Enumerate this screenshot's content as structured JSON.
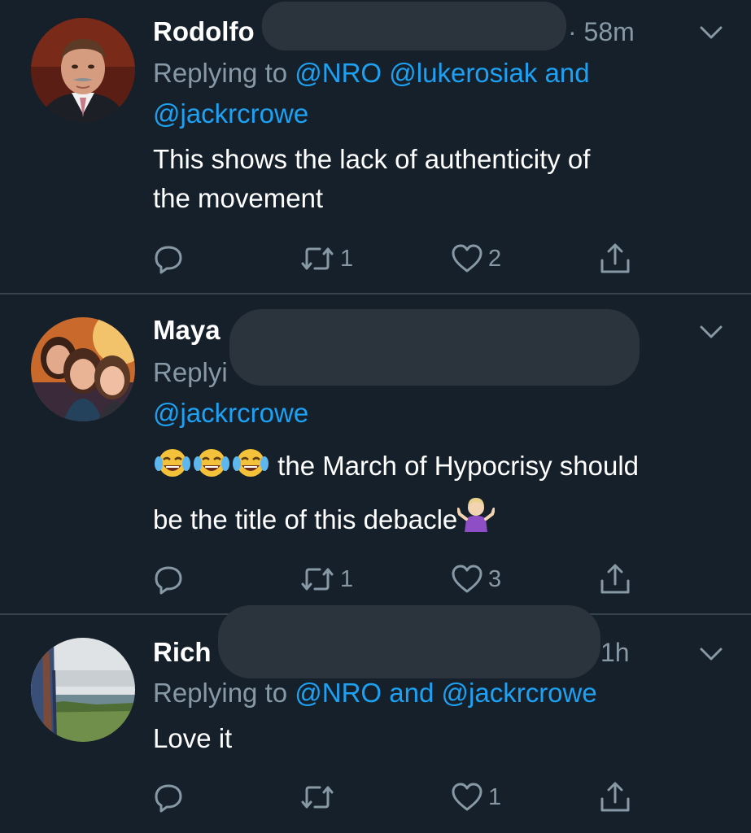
{
  "tweets": [
    {
      "name": "Rodolfo",
      "time": "· 58m",
      "reply_prefix": "Replying to ",
      "reply_mention1": "@NRO",
      "reply_mention2": "@lukerosiak",
      "reply_and": "and",
      "reply_mention3": "@jackrcrowe",
      "text_line1": "This shows the lack of authenticity of",
      "text_line2": "the movement",
      "retweets": "1",
      "likes": "2"
    },
    {
      "name": "Maya",
      "reply_prefix": "Replyi",
      "reply_mention3": "@jackrcrowe",
      "text_line1": "the March of Hypocrisy should",
      "text_line2": "be the title of this debacle",
      "emoji_line1": [
        "face-with-tears-of-joy",
        "face-with-tears-of-joy",
        "face-with-tears-of-joy"
      ],
      "emoji_line2": "person-shrugging",
      "retweets": "1",
      "likes": "3"
    },
    {
      "name": "Rich",
      "time": "1h",
      "reply_prefix": "Replying to ",
      "reply_mention1": "@NRO",
      "reply_and": "and",
      "reply_mention2": "@jackrcrowe",
      "text_line1": "Love it",
      "retweets": "",
      "likes": "1"
    }
  ],
  "colors": {
    "background": "#15202b",
    "divider": "#38444d",
    "secondary_text": "#8899a6",
    "link": "#1da1f2",
    "redaction": "#2b343d"
  },
  "icons": [
    "reply-icon",
    "retweet-icon",
    "like-icon",
    "share-icon",
    "chevron-down-icon"
  ]
}
